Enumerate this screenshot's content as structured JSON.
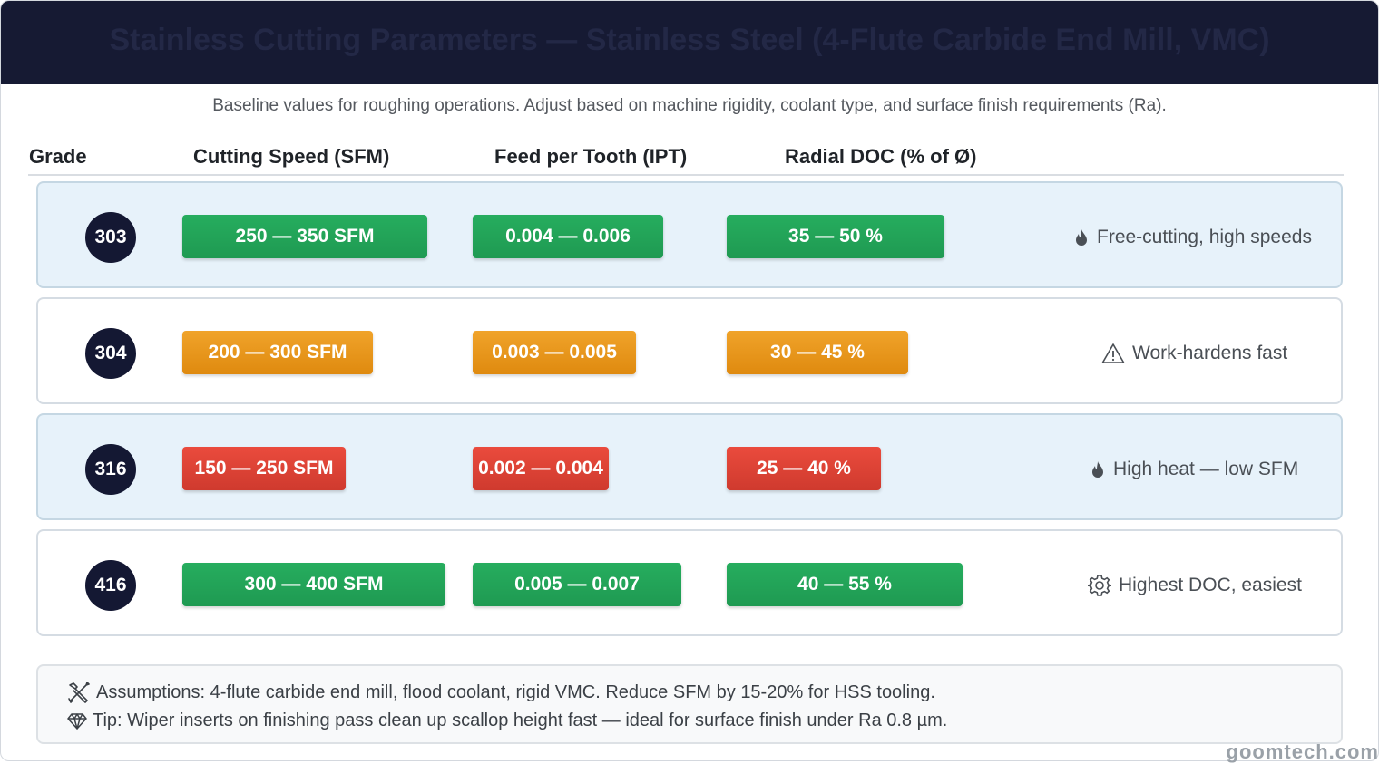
{
  "title": "Stainless Cutting Parameters — Stainless Steel (4-Flute Carbide End Mill, VMC)",
  "subtitle": "Baseline values for roughing operations. Adjust based on machine rigidity, coolant type, and surface finish requirements (Ra).",
  "columns": {
    "grade": "Grade",
    "speed": "Cutting Speed (SFM)",
    "feed": "Feed per Tooth (IPT)",
    "doc": "Radial DOC (% of Ø)"
  },
  "rows": [
    {
      "grade": "303",
      "speed": "250 — 350 SFM",
      "feed": "0.004 — 0.006",
      "doc": "35 — 50 %",
      "rating": "green",
      "note": "Free-cutting, high speeds",
      "icon": "flame-icon",
      "colors": {
        "rating": "#22a358"
      }
    },
    {
      "grade": "304",
      "speed": "200 — 300 SFM",
      "feed": "0.003 — 0.005",
      "doc": "30 — 45 %",
      "rating": "orange",
      "note": "Work-hardens fast",
      "icon": "warning-icon",
      "colors": {
        "rating": "#e89619"
      }
    },
    {
      "grade": "316",
      "speed": "150 — 250 SFM",
      "feed": "0.002 — 0.004",
      "doc": "25 — 40 %",
      "rating": "red",
      "note": "High heat — low SFM",
      "icon": "flame-icon",
      "colors": {
        "rating": "#dd4234"
      }
    },
    {
      "grade": "416",
      "speed": "300 — 400 SFM",
      "feed": "0.005 — 0.007",
      "doc": "40 — 55 %",
      "rating": "green",
      "note": "Highest DOC, easiest",
      "icon": "gear-icon",
      "colors": {
        "rating": "#22a358"
      }
    }
  ],
  "footer": {
    "assumptions": "Assumptions: 4-flute carbide end mill, flood coolant, rigid VMC. Reduce SFM by 15-20% for HSS tooling.",
    "assumptions_icon": "tools-icon",
    "tip": "Tip: Wiper inserts on finishing pass clean up scallop height fast — ideal for surface finish under Ra 0.8 µm.",
    "tip_icon": "gem-icon"
  },
  "watermark": "goomtech.com",
  "colors": {
    "header_bg": "#161a33",
    "badge_bg": "#141833",
    "green": "#22a358",
    "orange": "#e89619",
    "red": "#dd4234",
    "shaded_row": "#e7f2fa"
  }
}
